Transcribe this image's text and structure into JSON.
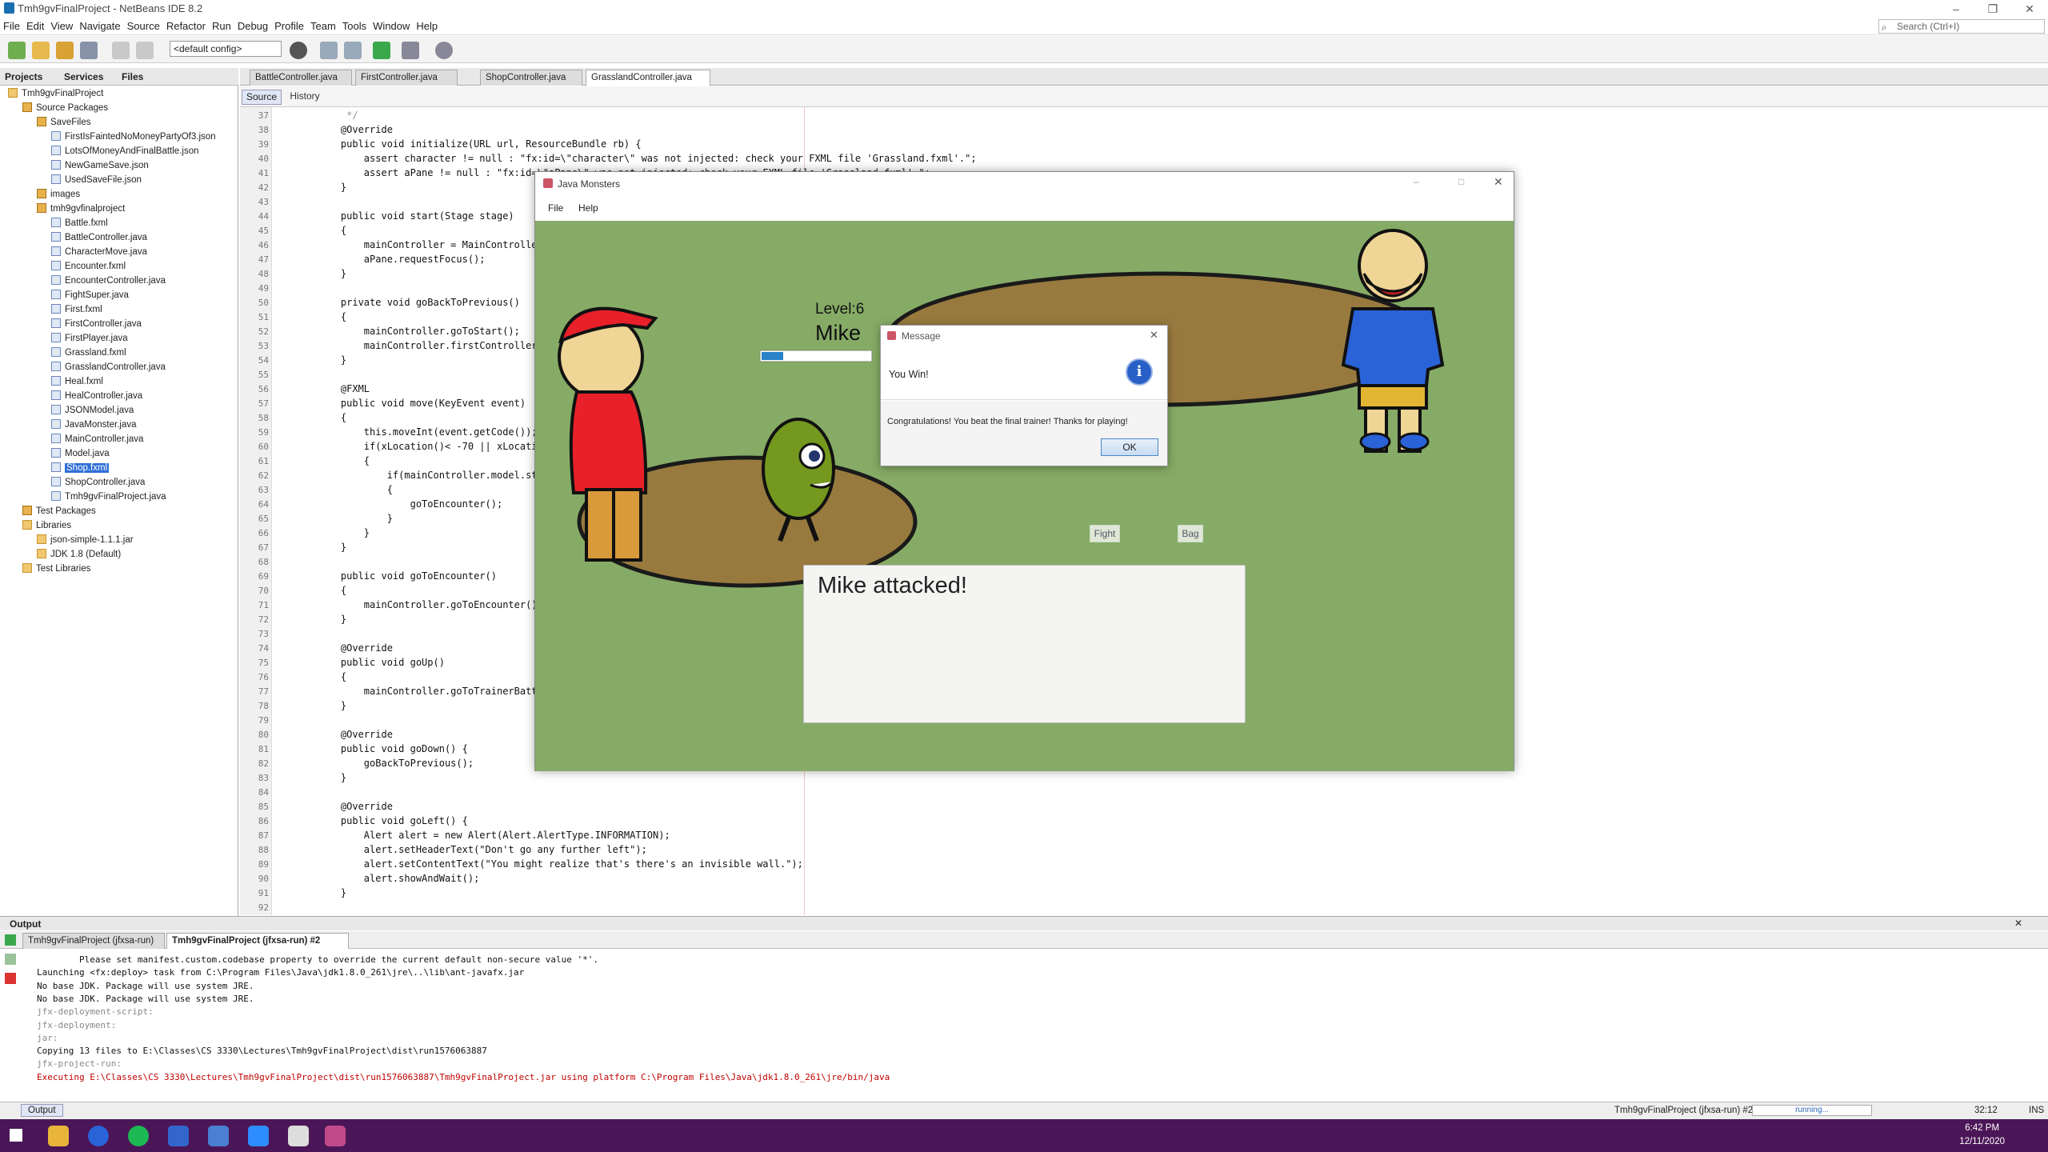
{
  "window": {
    "title": "Tmh9gvFinalProject - NetBeans IDE 8.2",
    "minimize": "–",
    "restore": "❐",
    "close": "✕"
  },
  "menu": [
    "File",
    "Edit",
    "View",
    "Navigate",
    "Source",
    "Refactor",
    "Run",
    "Debug",
    "Profile",
    "Team",
    "Tools",
    "Window",
    "Help"
  ],
  "search": {
    "placeholder": "Search (Ctrl+I)"
  },
  "toolbar": {
    "config": "<default config>"
  },
  "left_tabs": [
    "Projects",
    "Services",
    "Files"
  ],
  "tree": [
    {
      "label": "Tmh9gvFinalProject",
      "type": "project",
      "depth": 0
    },
    {
      "label": "Source Packages",
      "type": "pkg",
      "depth": 1
    },
    {
      "label": "SaveFiles",
      "type": "pkg",
      "depth": 2
    },
    {
      "label": "FirstIsFaintedNoMoneyPartyOf3.json",
      "type": "file",
      "depth": 3
    },
    {
      "label": "LotsOfMoneyAndFinalBattle.json",
      "type": "file",
      "depth": 3
    },
    {
      "label": "NewGameSave.json",
      "type": "file",
      "depth": 3
    },
    {
      "label": "UsedSaveFile.json",
      "type": "file",
      "depth": 3
    },
    {
      "label": "images",
      "type": "pkg",
      "depth": 2
    },
    {
      "label": "tmh9gvfinalproject",
      "type": "pkg",
      "depth": 2
    },
    {
      "label": "Battle.fxml",
      "type": "file",
      "depth": 3
    },
    {
      "label": "BattleController.java",
      "type": "file",
      "depth": 3
    },
    {
      "label": "CharacterMove.java",
      "type": "file",
      "depth": 3
    },
    {
      "label": "Encounter.fxml",
      "type": "file",
      "depth": 3
    },
    {
      "label": "EncounterController.java",
      "type": "file",
      "depth": 3
    },
    {
      "label": "FightSuper.java",
      "type": "file",
      "depth": 3
    },
    {
      "label": "First.fxml",
      "type": "file",
      "depth": 3
    },
    {
      "label": "FirstController.java",
      "type": "file",
      "depth": 3
    },
    {
      "label": "FirstPlayer.java",
      "type": "file",
      "depth": 3
    },
    {
      "label": "Grassland.fxml",
      "type": "file",
      "depth": 3
    },
    {
      "label": "GrasslandController.java",
      "type": "file",
      "depth": 3
    },
    {
      "label": "Heal.fxml",
      "type": "file",
      "depth": 3
    },
    {
      "label": "HealController.java",
      "type": "file",
      "depth": 3
    },
    {
      "label": "JSONModel.java",
      "type": "file",
      "depth": 3
    },
    {
      "label": "JavaMonster.java",
      "type": "file",
      "depth": 3
    },
    {
      "label": "MainController.java",
      "type": "file",
      "depth": 3
    },
    {
      "label": "Model.java",
      "type": "file",
      "depth": 3
    },
    {
      "label": "Shop.fxml",
      "type": "file",
      "depth": 3,
      "selected": true
    },
    {
      "label": "ShopController.java",
      "type": "file",
      "depth": 3
    },
    {
      "label": "Tmh9gvFinalProject.java",
      "type": "file",
      "depth": 3
    },
    {
      "label": "Test Packages",
      "type": "pkg",
      "depth": 1
    },
    {
      "label": "Libraries",
      "type": "folder",
      "depth": 1
    },
    {
      "label": "json-simple-1.1.1.jar",
      "type": "folder",
      "depth": 2
    },
    {
      "label": "JDK 1.8 (Default)",
      "type": "folder",
      "depth": 2
    },
    {
      "label": "Test Libraries",
      "type": "folder",
      "depth": 1
    }
  ],
  "editor_tabs": [
    "BattleController.java",
    "FirstController.java",
    "ShopController.java",
    "GrasslandController.java"
  ],
  "editor_active_tab": "GrasslandController.java",
  "editor_subtabs": {
    "source": "Source",
    "history": "History"
  },
  "code": [
    {
      "n": "37",
      "t": "     */",
      "c": "cmt"
    },
    {
      "n": "38",
      "t": "    @Override"
    },
    {
      "n": "39",
      "t": "    public void initialize(URL url, ResourceBundle rb) {"
    },
    {
      "n": "40",
      "t": "        assert character != null : \"fx:id=\\\"character\\\" was not injected: check your FXML file 'Grassland.fxml'.\";"
    },
    {
      "n": "41",
      "t": "        assert aPane != null : \"fx:id=\\\"aPane\\\" was not injected: check your FXML file 'Grassland.fxml'.\";"
    },
    {
      "n": "42",
      "t": "    }"
    },
    {
      "n": "43",
      "t": ""
    },
    {
      "n": "44",
      "t": "    public void start(Stage stage)"
    },
    {
      "n": "45",
      "t": "    {"
    },
    {
      "n": "46",
      "t": "        mainController = MainController"
    },
    {
      "n": "47",
      "t": "        aPane.requestFocus();"
    },
    {
      "n": "48",
      "t": "    }"
    },
    {
      "n": "49",
      "t": ""
    },
    {
      "n": "50",
      "t": "    private void goBackToPrevious()"
    },
    {
      "n": "51",
      "t": "    {"
    },
    {
      "n": "52",
      "t": "        mainController.goToStart();"
    },
    {
      "n": "53",
      "t": "        mainController.firstController"
    },
    {
      "n": "54",
      "t": "    }"
    },
    {
      "n": "55",
      "t": ""
    },
    {
      "n": "56",
      "t": "    @FXML"
    },
    {
      "n": "57",
      "t": "    public void move(KeyEvent event)"
    },
    {
      "n": "58",
      "t": "    {"
    },
    {
      "n": "59",
      "t": "        this.moveInt(event.getCode());"
    },
    {
      "n": "60",
      "t": "        if(xLocation()< -70 || xLocati"
    },
    {
      "n": "61",
      "t": "        {"
    },
    {
      "n": "62",
      "t": "            if(mainController.model.st"
    },
    {
      "n": "63",
      "t": "            {"
    },
    {
      "n": "64",
      "t": "                goToEncounter();"
    },
    {
      "n": "65",
      "t": "            }"
    },
    {
      "n": "66",
      "t": "        }"
    },
    {
      "n": "67",
      "t": "    }"
    },
    {
      "n": "68",
      "t": ""
    },
    {
      "n": "69",
      "t": "    public void goToEncounter()"
    },
    {
      "n": "70",
      "t": "    {"
    },
    {
      "n": "71",
      "t": "        mainController.goToEncounter()"
    },
    {
      "n": "72",
      "t": "    }"
    },
    {
      "n": "73",
      "t": ""
    },
    {
      "n": "74",
      "t": "    @Override"
    },
    {
      "n": "75",
      "t": "    public void goUp()"
    },
    {
      "n": "76",
      "t": "    {"
    },
    {
      "n": "77",
      "t": "        mainController.goToTrainerBatt"
    },
    {
      "n": "78",
      "t": "    }"
    },
    {
      "n": "79",
      "t": ""
    },
    {
      "n": "80",
      "t": "    @Override"
    },
    {
      "n": "81",
      "t": "    public void goDown() {"
    },
    {
      "n": "82",
      "t": "        goBackToPrevious();"
    },
    {
      "n": "83",
      "t": "    }"
    },
    {
      "n": "84",
      "t": ""
    },
    {
      "n": "85",
      "t": "    @Override"
    },
    {
      "n": "86",
      "t": "    public void goLeft() {"
    },
    {
      "n": "87",
      "t": "        Alert alert = new Alert(Alert.AlertType.INFORMATION);"
    },
    {
      "n": "88",
      "t": "        alert.setHeaderText(\"Don't go any further left\");"
    },
    {
      "n": "89",
      "t": "        alert.setContentText(\"You might realize that's there's an invisible wall.\");"
    },
    {
      "n": "90",
      "t": "        alert.showAndWait();"
    },
    {
      "n": "91",
      "t": "    }"
    },
    {
      "n": "92",
      "t": ""
    }
  ],
  "game": {
    "title": "Java Monsters",
    "menu": [
      "File",
      "Help"
    ],
    "level": "Level:6",
    "player_name": "Mike",
    "hp_fraction": 0.2,
    "fight": "Fight",
    "bag": "Bag",
    "message": "Mike attacked!"
  },
  "dialog": {
    "title": "Message",
    "header": "You Win!",
    "content": "Congratulations! You beat the final trainer! Thanks for playing!",
    "ok": "OK",
    "info_icon": "i"
  },
  "output": {
    "title": "Output",
    "tabs": [
      "Tmh9gvFinalProject (jfxsa-run)",
      "Tmh9gvFinalProject (jfxsa-run) #2"
    ],
    "lines": [
      {
        "t": "        Please set manifest.custom.codebase property to override the current default non-secure value '*'.",
        "k": ""
      },
      {
        "t": "Launching <fx:deploy> task from C:\\Program Files\\Java\\jdk1.8.0_261\\jre\\..\\lib\\ant-javafx.jar",
        "k": ""
      },
      {
        "t": "No base JDK. Package will use system JRE.",
        "k": ""
      },
      {
        "t": "No base JDK. Package will use system JRE.",
        "k": ""
      },
      {
        "t": "jfx-deployment-script:",
        "k": "g"
      },
      {
        "t": "jfx-deployment:",
        "k": "g"
      },
      {
        "t": "jar:",
        "k": "g"
      },
      {
        "t": "Copying 13 files to E:\\Classes\\CS 3330\\Lectures\\Tmh9gvFinalProject\\dist\\run1576063887",
        "k": ""
      },
      {
        "t": "jfx-project-run:",
        "k": "g"
      },
      {
        "t": "Executing E:\\Classes\\CS 3330\\Lectures\\Tmh9gvFinalProject\\dist\\run1576063887\\Tmh9gvFinalProject.jar using platform C:\\Program Files\\Java\\jdk1.8.0_261\\jre/bin/java",
        "k": "r"
      }
    ]
  },
  "status": {
    "output_tab": "Output",
    "task": "Tmh9gvFinalProject (jfxsa-run) #2",
    "progress": "running...",
    "position": "32:12",
    "mode": "INS"
  },
  "clock": {
    "time": "6:42 PM",
    "date": "12/11/2020"
  }
}
